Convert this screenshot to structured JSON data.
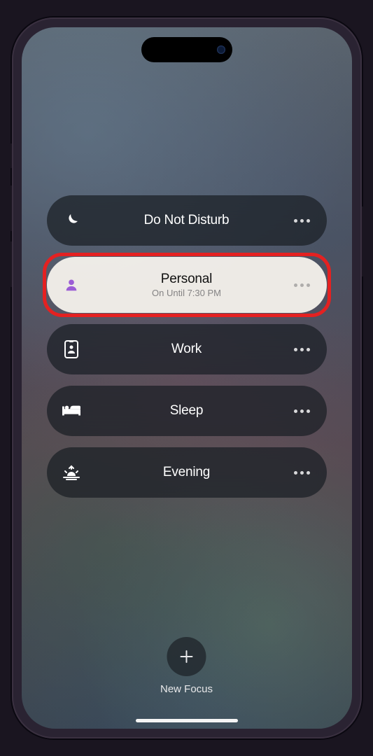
{
  "focus_modes": [
    {
      "id": "dnd",
      "label": "Do Not Disturb",
      "icon": "moon-icon",
      "active": false
    },
    {
      "id": "personal",
      "label": "Personal",
      "subtitle": "On Until 7:30 PM",
      "icon": "person-icon",
      "active": true
    },
    {
      "id": "work",
      "label": "Work",
      "icon": "badge-icon",
      "active": false
    },
    {
      "id": "sleep",
      "label": "Sleep",
      "icon": "bed-icon",
      "active": false
    },
    {
      "id": "evening",
      "label": "Evening",
      "icon": "sunset-icon",
      "active": false
    }
  ],
  "new_focus": {
    "label": "New Focus"
  },
  "colors": {
    "highlight": "#ff1a1a",
    "personal_accent": "#a259e6"
  }
}
